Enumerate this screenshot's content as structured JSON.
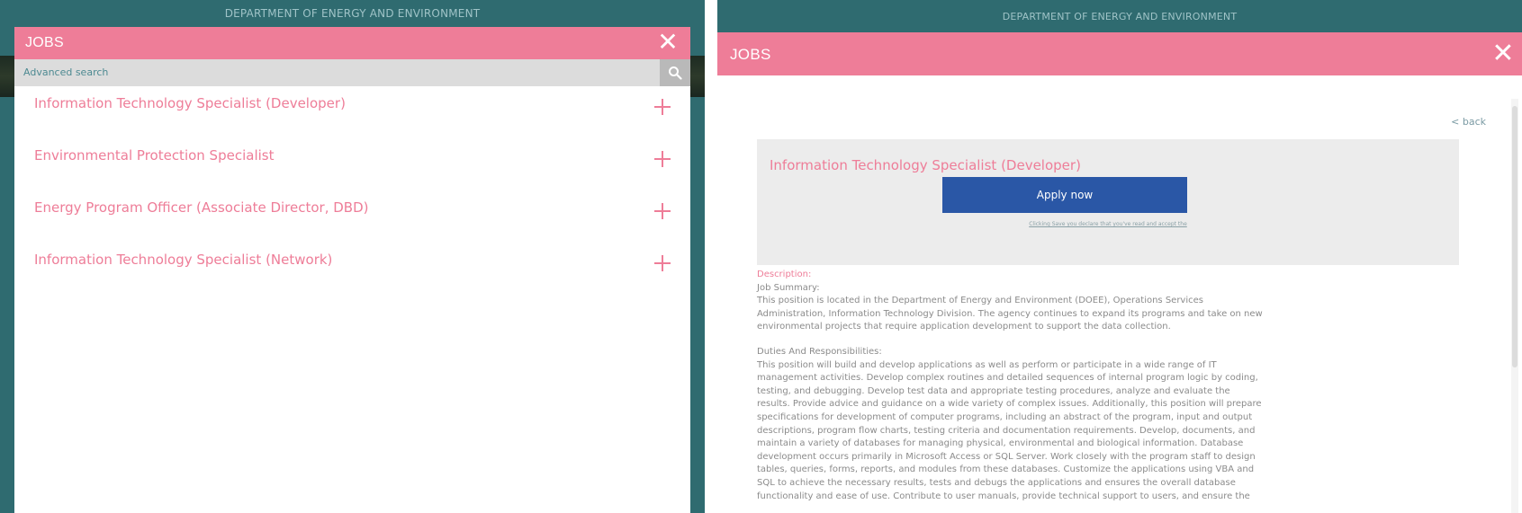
{
  "left": {
    "department": "DEPARTMENT OF ENERGY AND ENVIRONMENT",
    "modal_title": "JOBS",
    "close_symbol": "✕",
    "advanced_search": "Advanced search",
    "jobs": [
      "Information Technology Specialist (Developer)",
      "Environmental Protection Specialist",
      "Energy Program Officer (Associate Director, DBD)",
      "Information Technology Specialist (Network)"
    ]
  },
  "right": {
    "department": "DEPARTMENT OF ENERGY AND ENVIRONMENT",
    "modal_title": "JOBS",
    "close_symbol": "✕",
    "back_link": "< back",
    "job_title": "Information Technology Specialist (Developer)",
    "apply_label": "Apply now",
    "consent_text": "Clicking Save you declare that you've read and accept the",
    "description_label": "Description:",
    "job_summary_heading": "Job Summary:",
    "summary_lines": [
      "This position is located in the Department of Energy and Environment (DOEE), Operations Services",
      "Administration, Information Technology Division.  The agency continues to expand its programs and take on new",
      "environmental projects that require application development to support the data collection."
    ],
    "duties_heading": "Duties And Responsibilities:",
    "duties_lines": [
      "This position will build and develop applications as well as perform or participate in a wide range of IT",
      "management activities.  Develop complex routines and detailed sequences of internal program logic by coding,",
      "testing, and debugging.  Develop test data and appropriate testing procedures, analyze and evaluate the",
      "results.  Provide advice and guidance on a wide variety of complex issues.  Additionally, this position will prepare",
      "specifications for development of computer programs, including an abstract of the program, input and output",
      "descriptions, program flow charts, testing criteria and documentation requirements.  Develop, documents, and",
      "maintain a variety of databases for managing physical, environmental and biological information.  Database",
      "development occurs primarily in Microsoft Access or SQL Server.  Work closely with the program staff to design",
      "tables, queries, forms, reports, and modules from these databases.  Customize the applications using VBA and",
      "SQL to achieve the necessary results, tests and debugs the applications and ensures the overall database",
      "functionality and ease of use.  Contribute to user manuals, provide technical support to users, and ensure the"
    ]
  },
  "colors": {
    "header_pink": "#ee7d98",
    "teal_bar": "#2f6b70",
    "apply_blue": "#2a57a6"
  },
  "icons": {
    "search": "search-icon",
    "close": "close-icon",
    "expand": "plus-icon"
  }
}
